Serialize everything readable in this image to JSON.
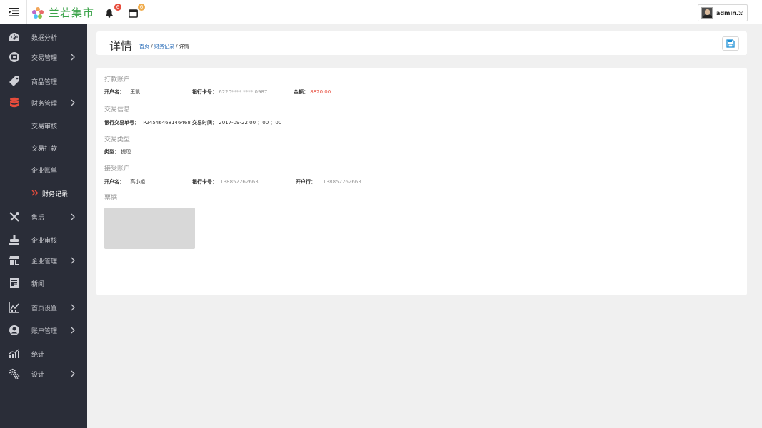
{
  "app": {
    "name": "兰若集市"
  },
  "topbar": {
    "notifications_count": "6",
    "messages_count": "6",
    "user_name": "admin..."
  },
  "sidebar": {
    "items": [
      {
        "label": "数据分析",
        "icon": "dashboard-icon"
      },
      {
        "label": "交易管理",
        "icon": "exchange-icon"
      },
      {
        "label": "商品管理",
        "icon": "tag-icon"
      },
      {
        "label": "财务管理",
        "icon": "database-icon"
      },
      {
        "label": "售后",
        "icon": "tools-icon"
      },
      {
        "label": "企业审核",
        "icon": "stamp-icon"
      },
      {
        "label": "企业管理",
        "icon": "store-icon"
      },
      {
        "label": "新闻",
        "icon": "newspaper-icon"
      },
      {
        "label": "首页设置",
        "icon": "chart-settings-icon"
      },
      {
        "label": "账户管理",
        "icon": "user-circle-icon"
      },
      {
        "label": "统计",
        "icon": "stats-icon"
      },
      {
        "label": "设计",
        "icon": "gears-icon"
      }
    ],
    "finance_sub": [
      {
        "label": "交易审核"
      },
      {
        "label": "交易打款"
      },
      {
        "label": "企业账单"
      },
      {
        "label": "财务记录"
      }
    ],
    "accent_color": "#e74c3c"
  },
  "header": {
    "title": "详情",
    "breadcrumb": {
      "home": "首页",
      "sep": "/",
      "parent": "财务记录",
      "current": "详情"
    }
  },
  "detail": {
    "payer": {
      "title": "打款账户",
      "holder_label": "开户名：",
      "holder_value": "王凯",
      "card_label": "银行卡号：",
      "card_value": "6220**** **** 0987",
      "amount_label": "金额：",
      "amount_value": "8820.00"
    },
    "transaction": {
      "title": "交易信息",
      "serial_label": "银行交易单号：",
      "serial_value": "P24546468146468",
      "time_label": "交易时间：",
      "time_value": "2017-09-22  00 ：00 ：00"
    },
    "type": {
      "title": "交易类型",
      "type_label": "类型：",
      "type_value": "提现"
    },
    "receiver": {
      "title": "接受账户",
      "holder_label": "开户名：",
      "holder_value": "高小姐",
      "card_label": "银行卡号：",
      "card_value": "138852262663",
      "bank_label": "开户行：",
      "bank_value": "138852262663"
    },
    "receipt": {
      "title": "票据"
    }
  }
}
